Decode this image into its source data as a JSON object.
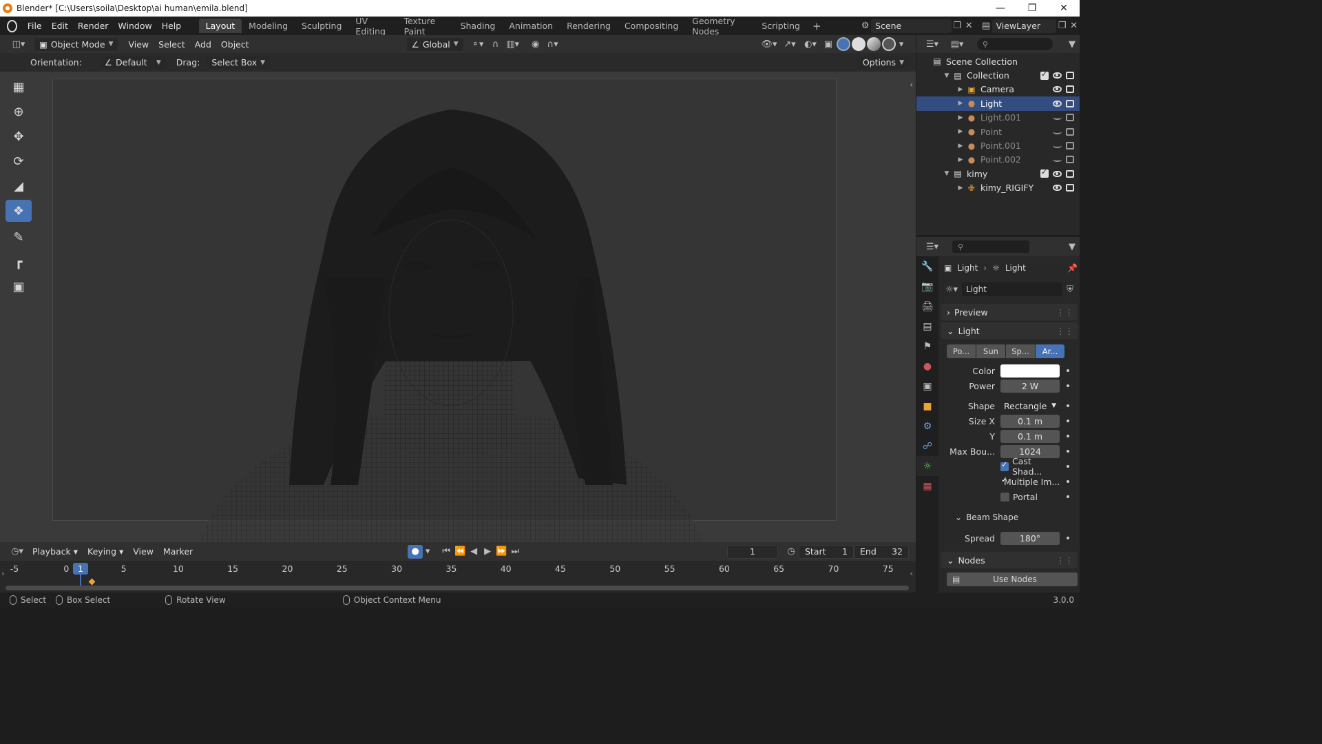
{
  "titlebar": {
    "title": "Blender* [C:\\Users\\soila\\Desktop\\ai human\\emila.blend]"
  },
  "menubar": {
    "menus": [
      "File",
      "Edit",
      "Render",
      "Window",
      "Help"
    ],
    "workspaces": [
      "Layout",
      "Modeling",
      "Sculpting",
      "UV Editing",
      "Texture Paint",
      "Shading",
      "Animation",
      "Rendering",
      "Compositing",
      "Geometry Nodes",
      "Scripting"
    ],
    "active_workspace": "Layout",
    "scene": "Scene",
    "view_layer": "ViewLayer"
  },
  "viewport_header": {
    "mode": "Object Mode",
    "menus": [
      "View",
      "Select",
      "Add",
      "Object"
    ],
    "transform_orientation": "Global"
  },
  "tool_settings": {
    "orientation_label": "Orientation:",
    "orientation_value": "Default",
    "drag_label": "Drag:",
    "drag_value": "Select Box",
    "options": "Options"
  },
  "toolbar": {
    "tools": [
      "select-box",
      "cursor",
      "move",
      "rotate",
      "scale",
      "transform",
      "annotate",
      "measure",
      "add-cube"
    ],
    "active_tool": "transform"
  },
  "timeline": {
    "menus": [
      "Playback",
      "Keying",
      "View",
      "Marker"
    ],
    "current_frame": "1",
    "start_label": "Start",
    "start": "1",
    "end_label": "End",
    "end": "32",
    "ticks": [
      "-5",
      "0",
      "5",
      "10",
      "15",
      "20",
      "25",
      "30",
      "35",
      "40",
      "45",
      "50",
      "55",
      "60",
      "65",
      "70",
      "75"
    ]
  },
  "statusbar": {
    "items": [
      "Select",
      "Box Select",
      "Rotate View",
      "Object Context Menu"
    ],
    "version": "3.0.0"
  },
  "outliner": {
    "root": "Scene Collection",
    "rows": [
      {
        "label": "Collection",
        "indent": 1,
        "kind": "collection",
        "expanded": true
      },
      {
        "label": "Camera",
        "indent": 2,
        "kind": "camera"
      },
      {
        "label": "Light",
        "indent": 2,
        "kind": "light",
        "selected": true
      },
      {
        "label": "Light.001",
        "indent": 2,
        "kind": "light",
        "hidden": true
      },
      {
        "label": "Point",
        "indent": 2,
        "kind": "light",
        "hidden": true
      },
      {
        "label": "Point.001",
        "indent": 2,
        "kind": "light",
        "hidden": true
      },
      {
        "label": "Point.002",
        "indent": 2,
        "kind": "light",
        "hidden": true
      },
      {
        "label": "kimy",
        "indent": 1,
        "kind": "collection",
        "expanded": true
      },
      {
        "label": "kimy_RIGIFY",
        "indent": 2,
        "kind": "armature"
      }
    ]
  },
  "properties": {
    "breadcrumb_object": "Light",
    "breadcrumb_data": "Light",
    "datablock": "Light",
    "preview_panel": "Preview",
    "light_panel": "Light",
    "light_types": [
      "Po...",
      "Sun",
      "Sp...",
      "Ar..."
    ],
    "active_light_type": "Ar...",
    "color_label": "Color",
    "color_value": "#ffffff",
    "power_label": "Power",
    "power": "2 W",
    "shape_label": "Shape",
    "shape": "Rectangle",
    "sizex_label": "Size X",
    "sizex": "0.1 m",
    "sizey_label": "Y",
    "sizey": "0.1 m",
    "maxbounces_label": "Max Bou...",
    "maxbounces": "1024",
    "cast_shadow": "Cast Shad...",
    "multiple_importance": "Multiple Im...",
    "portal": "Portal",
    "beam_panel": "Beam Shape",
    "spread_label": "Spread",
    "spread": "180°",
    "nodes_panel": "Nodes",
    "use_nodes": "Use Nodes"
  },
  "colors": {
    "accent": "#4772b3",
    "selected_row": "#334d80"
  }
}
